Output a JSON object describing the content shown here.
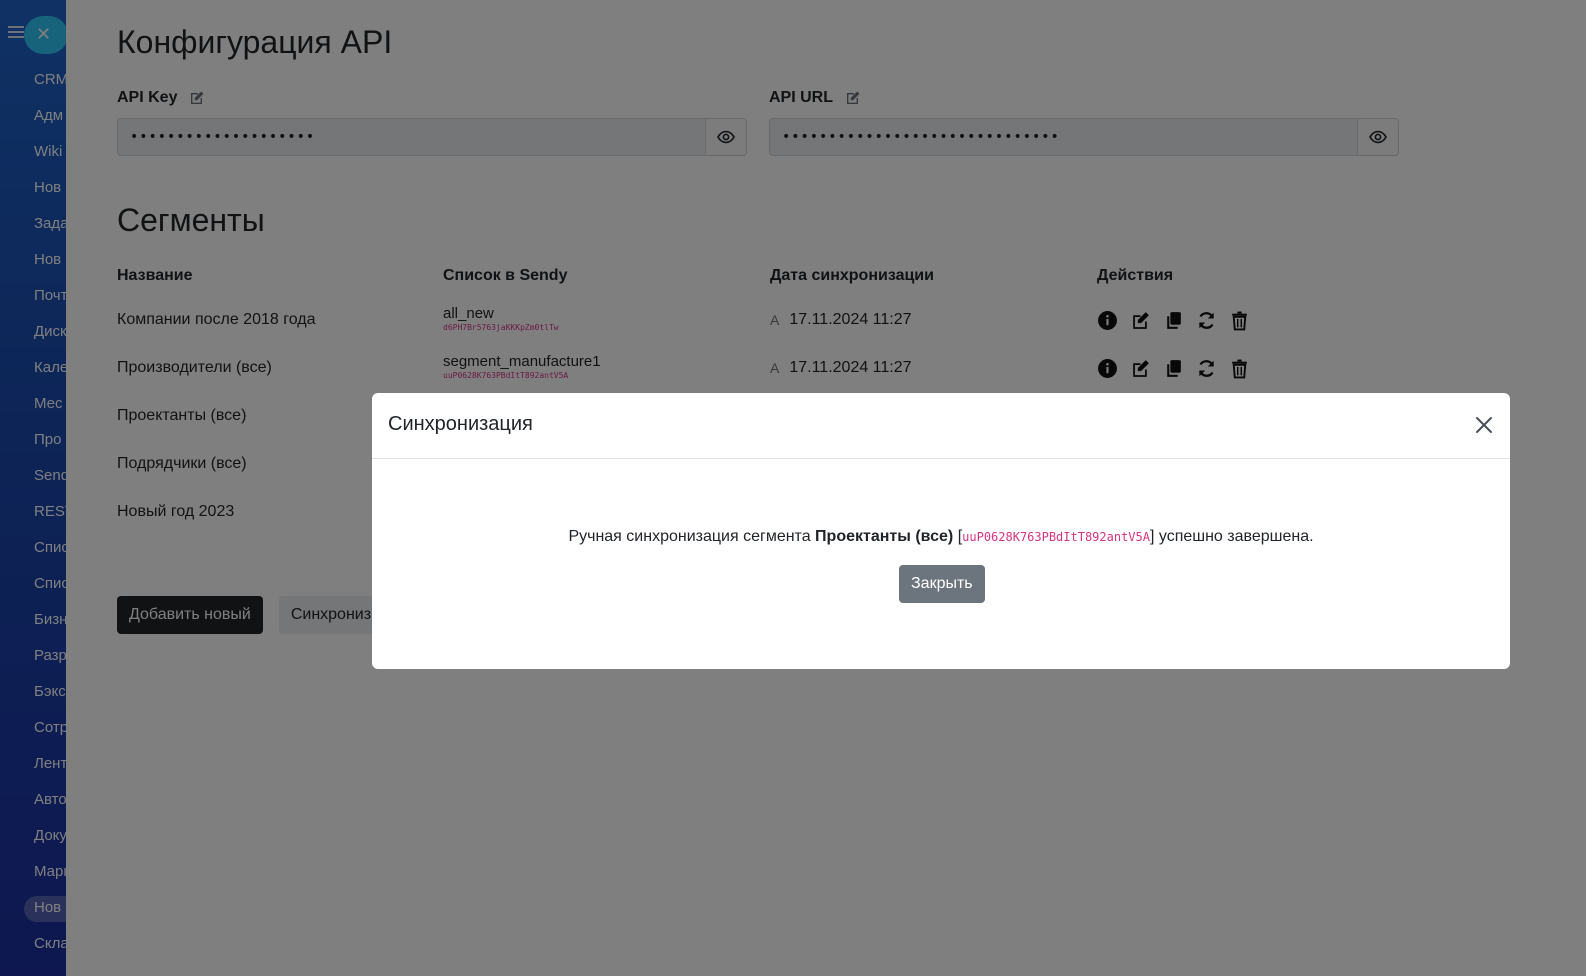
{
  "sidebar": {
    "items": [
      "CRM",
      "Адм",
      "Wiki",
      "Нов",
      "Зада",
      "Нов",
      "Почт",
      "Диск",
      "Кале",
      "Мес",
      "Про",
      "Send",
      "REST",
      "Спис",
      "Спис",
      "Бизн",
      "Разр",
      "Бэкс",
      "Сотр",
      "Лент",
      "Авто",
      "Доку",
      "Марк",
      "Нов",
      "Скла"
    ],
    "active_index": 23
  },
  "page": {
    "title": "Конфигурация API",
    "api_key": {
      "label": "API Key",
      "value": "••••••••••••••••••••"
    },
    "api_url": {
      "label": "API URL",
      "value": "••••••••••••••••••••••••••••••"
    }
  },
  "segments": {
    "title": "Сегменты",
    "headers": [
      "Название",
      "Список в Sendy",
      "Дата синхронизации",
      "Действия"
    ],
    "rows": [
      {
        "name": "Компании после 2018 года",
        "list_name": "all_new",
        "list_id": "d6PH7Br5763jaKKKpZm0tlTw",
        "sync_date": "17.11.2024 11:27"
      },
      {
        "name": "Производители (все)",
        "list_name": "segment_manufacture1",
        "list_id": "uuP0628K763PBdItT892antV5A",
        "sync_date": "17.11.2024 11:27"
      },
      {
        "name": "Проектанты (все)",
        "list_name": "",
        "list_id": "",
        "sync_date": ""
      },
      {
        "name": "Подрядчики (все)",
        "list_name": "",
        "list_id": "",
        "sync_date": ""
      },
      {
        "name": "Новый год 2023",
        "list_name": "",
        "list_id": "",
        "sync_date": ""
      }
    ],
    "auto_mark": "A",
    "add_button": "Добавить новый",
    "sync_button": "Синхронизировать"
  },
  "modal": {
    "title": "Синхронизация",
    "msg_prefix": "Ручная синхронизация сегмента",
    "msg_segment": "Проектанты (все)",
    "msg_open_bracket": "[",
    "msg_list_id": "uuP0628K763PBdItT892antV5A",
    "msg_suffix": "] успешно завершена.",
    "close_button": "Закрыть"
  },
  "colors": {
    "sidebar": "#1a4fb0",
    "accent_close": "#2fc6f6",
    "code": "#d63384",
    "btn_secondary": "#6c757d",
    "btn_dark": "#212529"
  }
}
